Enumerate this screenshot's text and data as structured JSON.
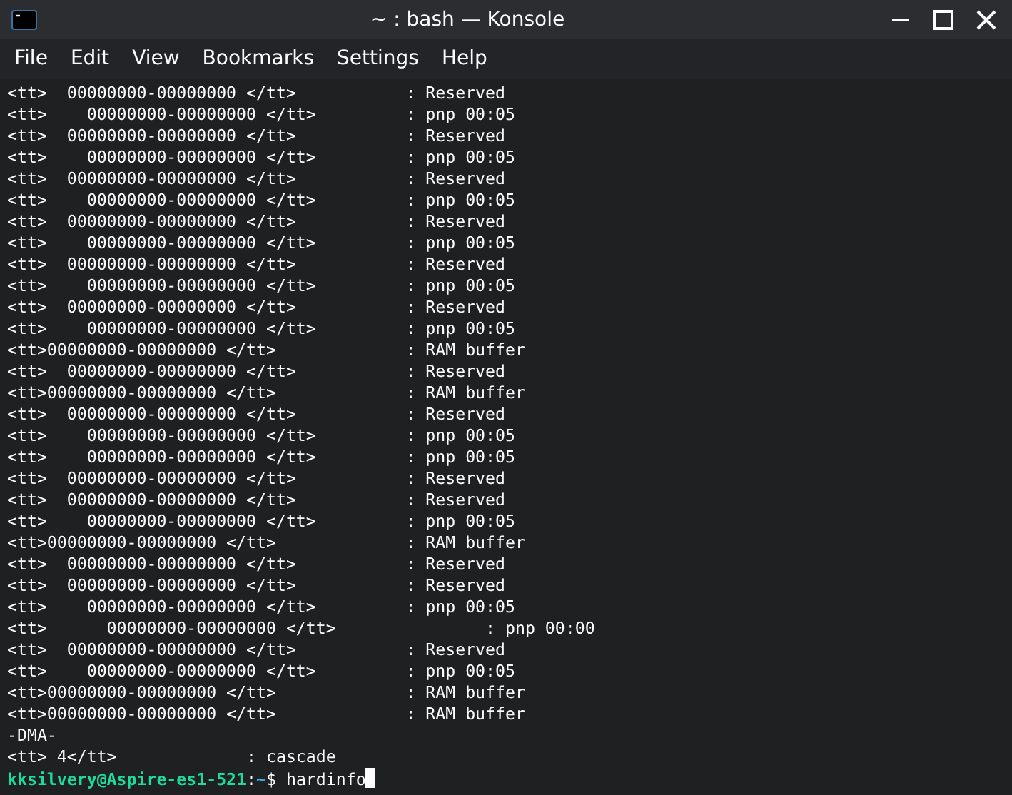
{
  "window": {
    "title": "~ : bash — Konsole"
  },
  "menu": [
    "File",
    "Edit",
    "View",
    "Bookmarks",
    "Settings",
    "Help"
  ],
  "terminal": {
    "lines": [
      "<tt>  00000000-00000000 </tt>           : Reserved",
      "<tt>    00000000-00000000 </tt>         : pnp 00:05",
      "<tt>  00000000-00000000 </tt>           : Reserved",
      "<tt>    00000000-00000000 </tt>         : pnp 00:05",
      "<tt>  00000000-00000000 </tt>           : Reserved",
      "<tt>    00000000-00000000 </tt>         : pnp 00:05",
      "<tt>  00000000-00000000 </tt>           : Reserved",
      "<tt>    00000000-00000000 </tt>         : pnp 00:05",
      "<tt>  00000000-00000000 </tt>           : Reserved",
      "<tt>    00000000-00000000 </tt>         : pnp 00:05",
      "<tt>  00000000-00000000 </tt>           : Reserved",
      "<tt>    00000000-00000000 </tt>         : pnp 00:05",
      "<tt>00000000-00000000 </tt>             : RAM buffer",
      "<tt>  00000000-00000000 </tt>           : Reserved",
      "<tt>00000000-00000000 </tt>             : RAM buffer",
      "<tt>  00000000-00000000 </tt>           : Reserved",
      "<tt>    00000000-00000000 </tt>         : pnp 00:05",
      "<tt>    00000000-00000000 </tt>         : pnp 00:05",
      "<tt>  00000000-00000000 </tt>           : Reserved",
      "<tt>  00000000-00000000 </tt>           : Reserved",
      "<tt>    00000000-00000000 </tt>         : pnp 00:05",
      "<tt>00000000-00000000 </tt>             : RAM buffer",
      "<tt>  00000000-00000000 </tt>           : Reserved",
      "<tt>  00000000-00000000 </tt>           : Reserved",
      "<tt>    00000000-00000000 </tt>         : pnp 00:05",
      "<tt>      00000000-00000000 </tt>               : pnp 00:00",
      "<tt>  00000000-00000000 </tt>           : Reserved",
      "<tt>    00000000-00000000 </tt>         : pnp 00:05",
      "<tt>00000000-00000000 </tt>             : RAM buffer",
      "<tt>00000000-00000000 </tt>             : RAM buffer",
      "-DMA-",
      "<tt> 4</tt>             : cascade"
    ],
    "prompt": [
      {
        "text": "kksilvery@Aspire-es1-521",
        "kind": "user"
      },
      {
        "text": ":",
        "kind": "plain"
      },
      {
        "text": "~",
        "kind": "path"
      },
      {
        "text": "$ hardinfo",
        "kind": "plain"
      }
    ]
  }
}
